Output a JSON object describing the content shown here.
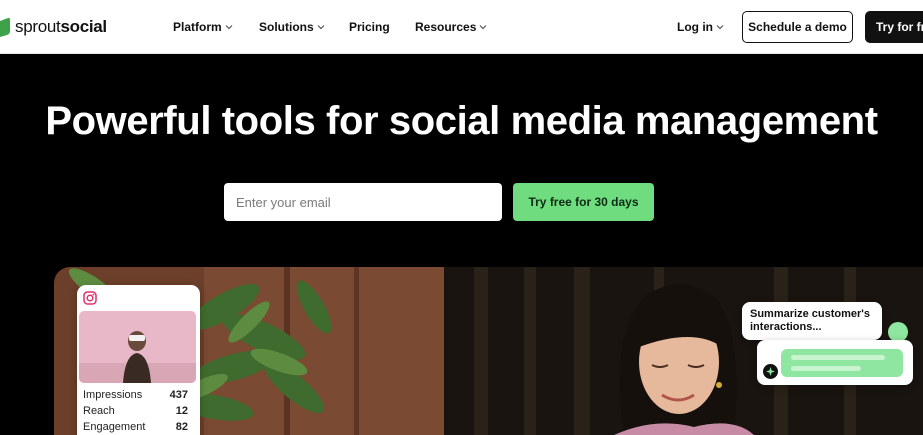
{
  "brand": {
    "name_part1": "sprout",
    "name_part2": "social",
    "color": "#3ea24a"
  },
  "nav": {
    "items": [
      {
        "label": "Platform",
        "has_dropdown": true
      },
      {
        "label": "Solutions",
        "has_dropdown": true
      },
      {
        "label": "Pricing",
        "has_dropdown": false
      },
      {
        "label": "Resources",
        "has_dropdown": true
      }
    ],
    "login": {
      "label": "Log in",
      "has_dropdown": true
    },
    "schedule_demo": "Schedule a demo",
    "try_free": "Try for free"
  },
  "hero": {
    "headline": "Powerful tools for social media management",
    "email_placeholder": "Enter your email",
    "cta": "Try free for 30 days",
    "cta_color": "#6fdc7f",
    "background": "#000000"
  },
  "instagram_card": {
    "icon": "instagram-icon",
    "stats": [
      {
        "label": "Impressions",
        "value": "437"
      },
      {
        "label": "Reach",
        "value": "12"
      },
      {
        "label": "Engagement",
        "value": "82"
      }
    ]
  },
  "ai_prompt": {
    "text": "Summarize customer's interactions..."
  }
}
